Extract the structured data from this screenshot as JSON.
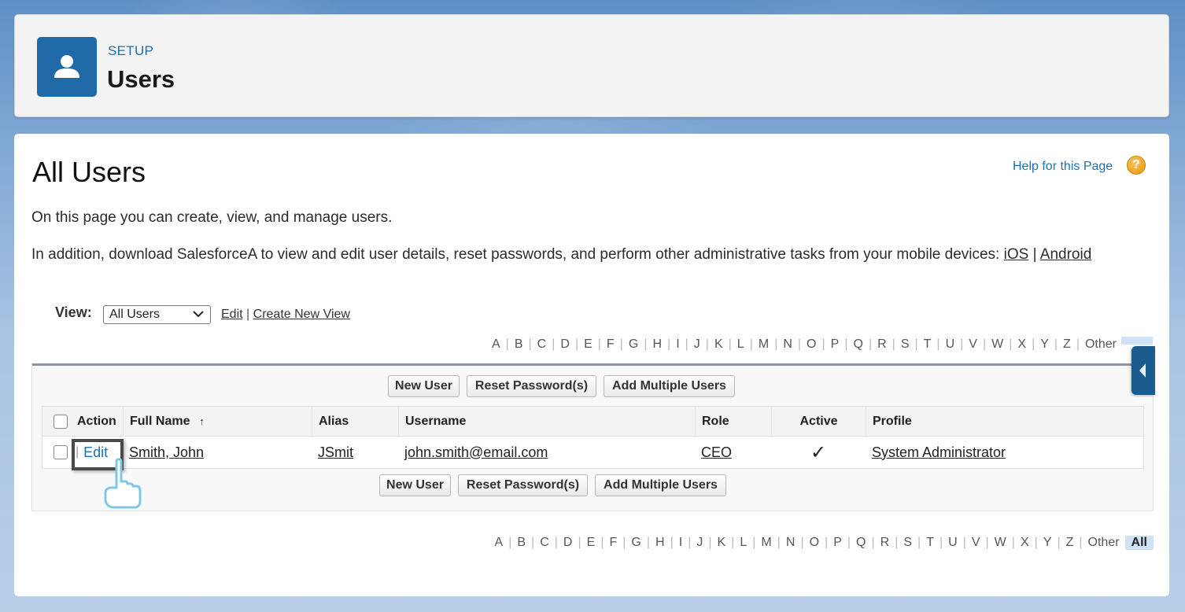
{
  "header": {
    "section_label": "SETUP",
    "title": "Users",
    "icon": "user-icon"
  },
  "main": {
    "title": "All Users",
    "help_link": "Help for this Page",
    "help_icon": "help-question-icon",
    "description": "On this page you can create, view, and manage users.",
    "mobile_prefix": "In addition, download SalesforceA to view and edit user details, reset passwords, and perform other administrative tasks from your mobile devices:",
    "mobile_ios": "iOS",
    "mobile_sep": "|",
    "mobile_android": "Android"
  },
  "view": {
    "label": "View:",
    "selected": "All Users",
    "edit_link": "Edit",
    "separator": "|",
    "create_link": "Create New View"
  },
  "alphabet": [
    "A",
    "B",
    "C",
    "D",
    "E",
    "F",
    "G",
    "H",
    "I",
    "J",
    "K",
    "L",
    "M",
    "N",
    "O",
    "P",
    "Q",
    "R",
    "S",
    "T",
    "U",
    "V",
    "W",
    "X",
    "Y",
    "Z",
    "Other"
  ],
  "alphabet_all": "All",
  "buttons": {
    "new_user": "New User",
    "reset_password": "Reset Password(s)",
    "add_multiple": "Add Multiple Users"
  },
  "table": {
    "columns": {
      "action": "Action",
      "full_name": "Full Name",
      "sort_indicator": "↑",
      "alias": "Alias",
      "username": "Username",
      "role": "Role",
      "active": "Active",
      "profile": "Profile"
    },
    "rows": [
      {
        "action_sep": "|",
        "action": "Edit",
        "full_name": "Smith, John",
        "alias": "JSmit",
        "username": "john.smith@email.com",
        "role": "CEO",
        "active": "✓",
        "profile": "System Administrator"
      }
    ]
  },
  "colors": {
    "brand_blue": "#1f6aa6",
    "link_blue": "#1e6fb0",
    "all_highlight": "#cfe3f7"
  }
}
